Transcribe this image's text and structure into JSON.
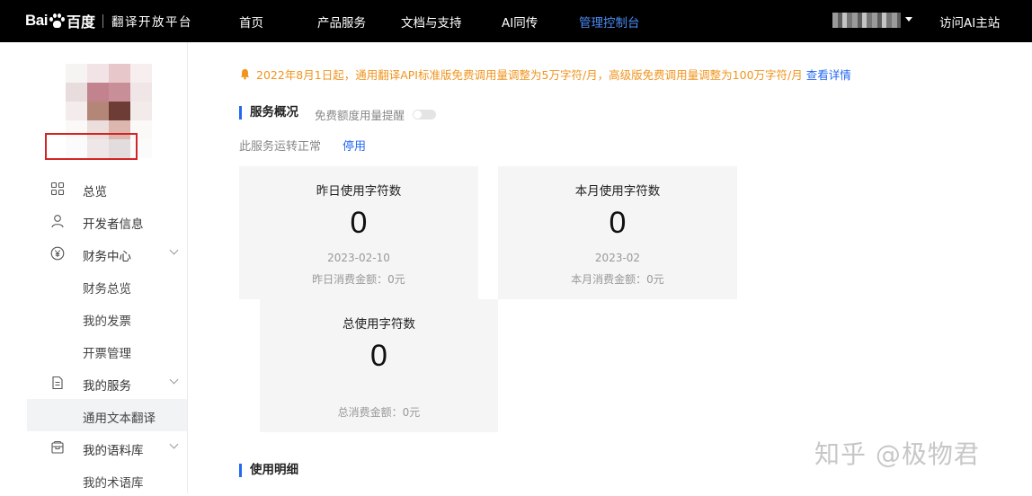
{
  "topbar": {
    "logo_bai": "Bai",
    "logo_du": "百度",
    "logo_subtitle": "翻译开放平台",
    "nav": [
      "首页",
      "产品服务",
      "文档与支持",
      "AI同传",
      "管理控制台"
    ],
    "active_nav": "管理控制台",
    "visit_label": "访问AI主站"
  },
  "sidebar": {
    "overview": "总览",
    "developer_info": "开发者信息",
    "finance_center": "财务中心",
    "finance_overview": "财务总览",
    "my_invoices": "我的发票",
    "invoice_mgmt": "开票管理",
    "my_services": "我的服务",
    "text_translation": "通用文本翻译",
    "my_corpus": "我的语料库",
    "my_terminology": "我的术语库"
  },
  "notice": {
    "text": "2022年8月1日起，通用翻译API标准版免费调用量调整为5万字符/月，高级版免费调用量调整为100万字符/月",
    "link": "查看详情"
  },
  "overview": {
    "title": "服务概况",
    "quota_reminder": "免费额度用量提醒",
    "status": "此服务运转正常",
    "stop": "停用"
  },
  "cards": {
    "yesterday": {
      "title": "昨日使用字符数",
      "value": "0",
      "date": "2023-02-10",
      "fee": "昨日消费金额：0元"
    },
    "month": {
      "title": "本月使用字符数",
      "value": "0",
      "date": "2023-02",
      "fee": "本月消费金额：0元"
    },
    "total": {
      "title": "总使用字符数",
      "value": "0",
      "fee": "总消费金额：0元"
    }
  },
  "usage_detail_title": "使用明细",
  "watermark": "知乎 @极物君",
  "colors": {
    "accent": "#2468f2",
    "notice": "#f0941e",
    "highlight_box": "#d32424",
    "topbar": "#000000"
  }
}
